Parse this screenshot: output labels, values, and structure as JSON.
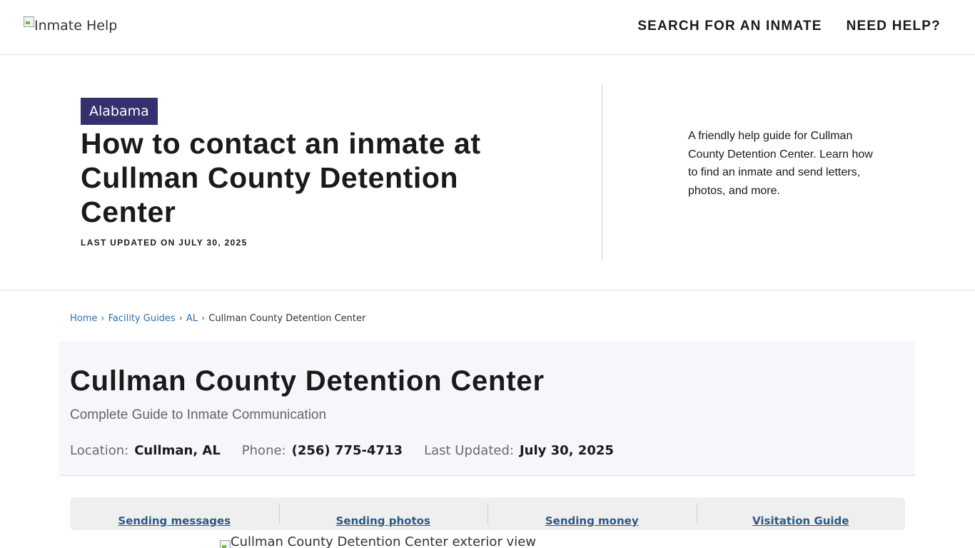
{
  "header": {
    "logo_alt": "Inmate Help",
    "nav": [
      {
        "label": "SEARCH FOR AN INMATE"
      },
      {
        "label": "NEED HELP?"
      }
    ]
  },
  "hero": {
    "state_badge": "Alabama",
    "title": "How to contact an inmate at Cullman County Detention Center",
    "last_updated": "LAST UPDATED ON JULY 30, 2025",
    "description": "A friendly help guide for Cullman County Detention Center. Learn how to find an inmate and send letters, photos, and more."
  },
  "breadcrumb": {
    "items": [
      {
        "label": "Home"
      },
      {
        "label": "Facility Guides"
      },
      {
        "label": "AL"
      },
      {
        "label": "Cullman County Detention Center"
      }
    ],
    "separator": "›"
  },
  "facility": {
    "title": "Cullman County Detention Center",
    "subtitle": "Complete Guide to Inmate Communication",
    "location_label": "Location:",
    "location_value": "Cullman, AL",
    "phone_label": "Phone:",
    "phone_value": "(256) 775-4713",
    "updated_label": "Last Updated:",
    "updated_value": "July 30, 2025"
  },
  "tabs": [
    {
      "label": "Sending messages"
    },
    {
      "label": "Sending photos"
    },
    {
      "label": "Sending money"
    },
    {
      "label": "Visitation Guide"
    }
  ],
  "exterior_image": {
    "alt": "Cullman County Detention Center exterior view"
  },
  "colors": {
    "badge_bg": "#36306e",
    "link": "#2f6fb0",
    "tab_link": "#2b5a88",
    "card_bg": "#f5f7fa"
  }
}
